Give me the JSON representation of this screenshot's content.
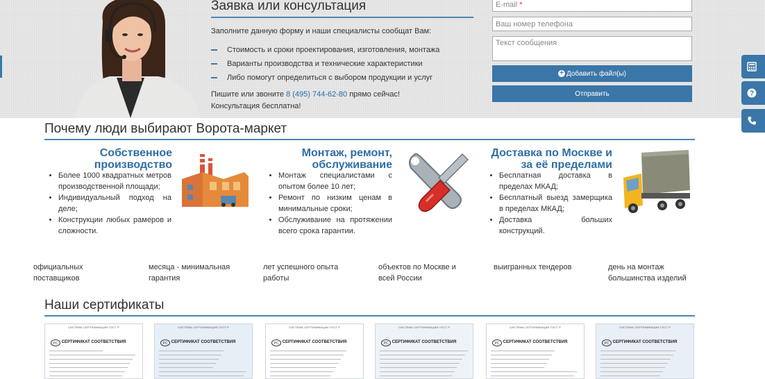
{
  "form": {
    "title": "Заявка или консультация",
    "intro": "Заполните данную форму и наши специалисты сообщат Вам:",
    "bullets": [
      "Стоимость и сроки проектирования, изготовления, монтажа",
      "Варианты производства и технические характеристики",
      "Либо помогут определиться с выбором продукции и услуг"
    ],
    "call_prefix": "Пишите или звоните",
    "phone": "8 (495) 744-62-80",
    "call_suffix": "прямо сейчас!",
    "free_note": "Консультация бесплатна!",
    "email_placeholder": "E-mail",
    "required_mark": "*",
    "phone_placeholder": "Ваш номер телефона",
    "message_placeholder": "Текст сообщения",
    "add_file_label": "Добавить файл(ы)",
    "send_label": "Отправить"
  },
  "side_tabs": [
    "calculator-icon",
    "question-icon",
    "phone-icon"
  ],
  "why": {
    "title": "Почему люди выбирают Ворота-маркет",
    "features": [
      {
        "title_line1": "Собственное",
        "title_line2": "производство",
        "icon": "factory-icon",
        "items": [
          "Более 1000 квадратных метров производственной площади;",
          "Индивидуальный подход на деле;",
          "Конструкции любых рамеров и сложности."
        ]
      },
      {
        "title_line1": "Монтаж, ремонт,",
        "title_line2": "обслуживание",
        "icon": "tools-icon",
        "items": [
          "Монтаж специалистами с опытом более 10 лет;",
          "Ремонт по низким ценам в минимальные сроки;",
          "Обслуживание на протяжении всего срока гарантии."
        ]
      },
      {
        "title_line1": "Доставка по Москве и",
        "title_line2": "за её пределами",
        "icon": "truck-icon",
        "items": [
          "Бесплатная доставка в пределах МКАД;",
          "Бесплатный выезд замерщика в пределах МКАД;",
          "Доставка больших конструкций."
        ]
      }
    ],
    "stats": [
      {
        "line1": "официальных",
        "line2": "поставщиков"
      },
      {
        "line1": "месяца - минимальная",
        "line2": "гарантия"
      },
      {
        "line1": "лет успешного опыта",
        "line2": "работы"
      },
      {
        "line1": "объектов по Москве и",
        "line2": "всей России"
      },
      {
        "line1": "выигранных тендеров",
        "line2": ""
      },
      {
        "line1": "день на монтаж",
        "line2": "большинства изделий"
      }
    ]
  },
  "certificates": {
    "title": "Наши сертификаты",
    "header_text": "СИСТЕМА СЕРТИФИКАЦИИ ГОСТ Р",
    "card_title": "СЕРТИФИКАТ СООТВЕТСТВИЯ",
    "count": 6
  }
}
